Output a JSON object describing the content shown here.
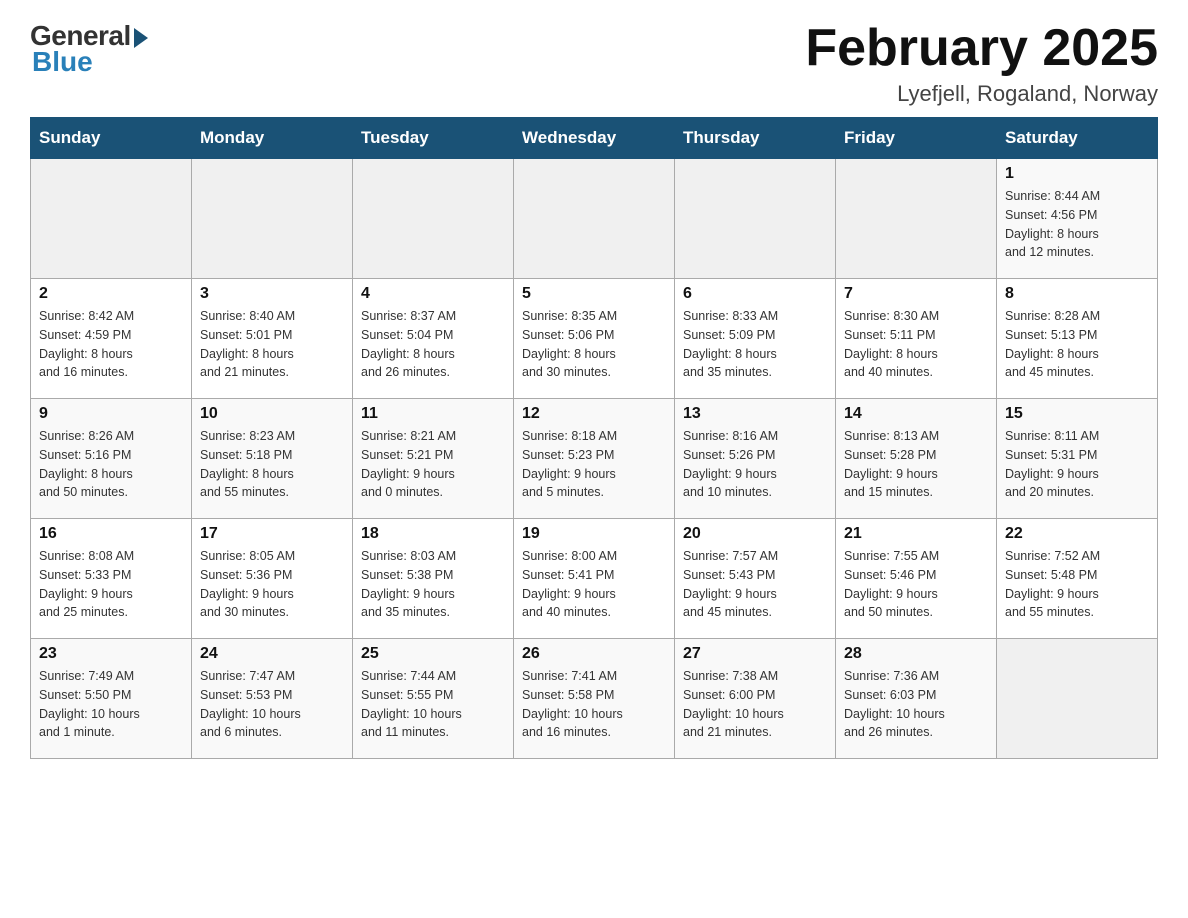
{
  "header": {
    "logo_general": "General",
    "logo_blue": "Blue",
    "month_title": "February 2025",
    "location": "Lyefjell, Rogaland, Norway"
  },
  "weekdays": [
    "Sunday",
    "Monday",
    "Tuesday",
    "Wednesday",
    "Thursday",
    "Friday",
    "Saturday"
  ],
  "weeks": [
    [
      {
        "day": "",
        "info": ""
      },
      {
        "day": "",
        "info": ""
      },
      {
        "day": "",
        "info": ""
      },
      {
        "day": "",
        "info": ""
      },
      {
        "day": "",
        "info": ""
      },
      {
        "day": "",
        "info": ""
      },
      {
        "day": "1",
        "info": "Sunrise: 8:44 AM\nSunset: 4:56 PM\nDaylight: 8 hours\nand 12 minutes."
      }
    ],
    [
      {
        "day": "2",
        "info": "Sunrise: 8:42 AM\nSunset: 4:59 PM\nDaylight: 8 hours\nand 16 minutes."
      },
      {
        "day": "3",
        "info": "Sunrise: 8:40 AM\nSunset: 5:01 PM\nDaylight: 8 hours\nand 21 minutes."
      },
      {
        "day": "4",
        "info": "Sunrise: 8:37 AM\nSunset: 5:04 PM\nDaylight: 8 hours\nand 26 minutes."
      },
      {
        "day": "5",
        "info": "Sunrise: 8:35 AM\nSunset: 5:06 PM\nDaylight: 8 hours\nand 30 minutes."
      },
      {
        "day": "6",
        "info": "Sunrise: 8:33 AM\nSunset: 5:09 PM\nDaylight: 8 hours\nand 35 minutes."
      },
      {
        "day": "7",
        "info": "Sunrise: 8:30 AM\nSunset: 5:11 PM\nDaylight: 8 hours\nand 40 minutes."
      },
      {
        "day": "8",
        "info": "Sunrise: 8:28 AM\nSunset: 5:13 PM\nDaylight: 8 hours\nand 45 minutes."
      }
    ],
    [
      {
        "day": "9",
        "info": "Sunrise: 8:26 AM\nSunset: 5:16 PM\nDaylight: 8 hours\nand 50 minutes."
      },
      {
        "day": "10",
        "info": "Sunrise: 8:23 AM\nSunset: 5:18 PM\nDaylight: 8 hours\nand 55 minutes."
      },
      {
        "day": "11",
        "info": "Sunrise: 8:21 AM\nSunset: 5:21 PM\nDaylight: 9 hours\nand 0 minutes."
      },
      {
        "day": "12",
        "info": "Sunrise: 8:18 AM\nSunset: 5:23 PM\nDaylight: 9 hours\nand 5 minutes."
      },
      {
        "day": "13",
        "info": "Sunrise: 8:16 AM\nSunset: 5:26 PM\nDaylight: 9 hours\nand 10 minutes."
      },
      {
        "day": "14",
        "info": "Sunrise: 8:13 AM\nSunset: 5:28 PM\nDaylight: 9 hours\nand 15 minutes."
      },
      {
        "day": "15",
        "info": "Sunrise: 8:11 AM\nSunset: 5:31 PM\nDaylight: 9 hours\nand 20 minutes."
      }
    ],
    [
      {
        "day": "16",
        "info": "Sunrise: 8:08 AM\nSunset: 5:33 PM\nDaylight: 9 hours\nand 25 minutes."
      },
      {
        "day": "17",
        "info": "Sunrise: 8:05 AM\nSunset: 5:36 PM\nDaylight: 9 hours\nand 30 minutes."
      },
      {
        "day": "18",
        "info": "Sunrise: 8:03 AM\nSunset: 5:38 PM\nDaylight: 9 hours\nand 35 minutes."
      },
      {
        "day": "19",
        "info": "Sunrise: 8:00 AM\nSunset: 5:41 PM\nDaylight: 9 hours\nand 40 minutes."
      },
      {
        "day": "20",
        "info": "Sunrise: 7:57 AM\nSunset: 5:43 PM\nDaylight: 9 hours\nand 45 minutes."
      },
      {
        "day": "21",
        "info": "Sunrise: 7:55 AM\nSunset: 5:46 PM\nDaylight: 9 hours\nand 50 minutes."
      },
      {
        "day": "22",
        "info": "Sunrise: 7:52 AM\nSunset: 5:48 PM\nDaylight: 9 hours\nand 55 minutes."
      }
    ],
    [
      {
        "day": "23",
        "info": "Sunrise: 7:49 AM\nSunset: 5:50 PM\nDaylight: 10 hours\nand 1 minute."
      },
      {
        "day": "24",
        "info": "Sunrise: 7:47 AM\nSunset: 5:53 PM\nDaylight: 10 hours\nand 6 minutes."
      },
      {
        "day": "25",
        "info": "Sunrise: 7:44 AM\nSunset: 5:55 PM\nDaylight: 10 hours\nand 11 minutes."
      },
      {
        "day": "26",
        "info": "Sunrise: 7:41 AM\nSunset: 5:58 PM\nDaylight: 10 hours\nand 16 minutes."
      },
      {
        "day": "27",
        "info": "Sunrise: 7:38 AM\nSunset: 6:00 PM\nDaylight: 10 hours\nand 21 minutes."
      },
      {
        "day": "28",
        "info": "Sunrise: 7:36 AM\nSunset: 6:03 PM\nDaylight: 10 hours\nand 26 minutes."
      },
      {
        "day": "",
        "info": ""
      }
    ]
  ]
}
